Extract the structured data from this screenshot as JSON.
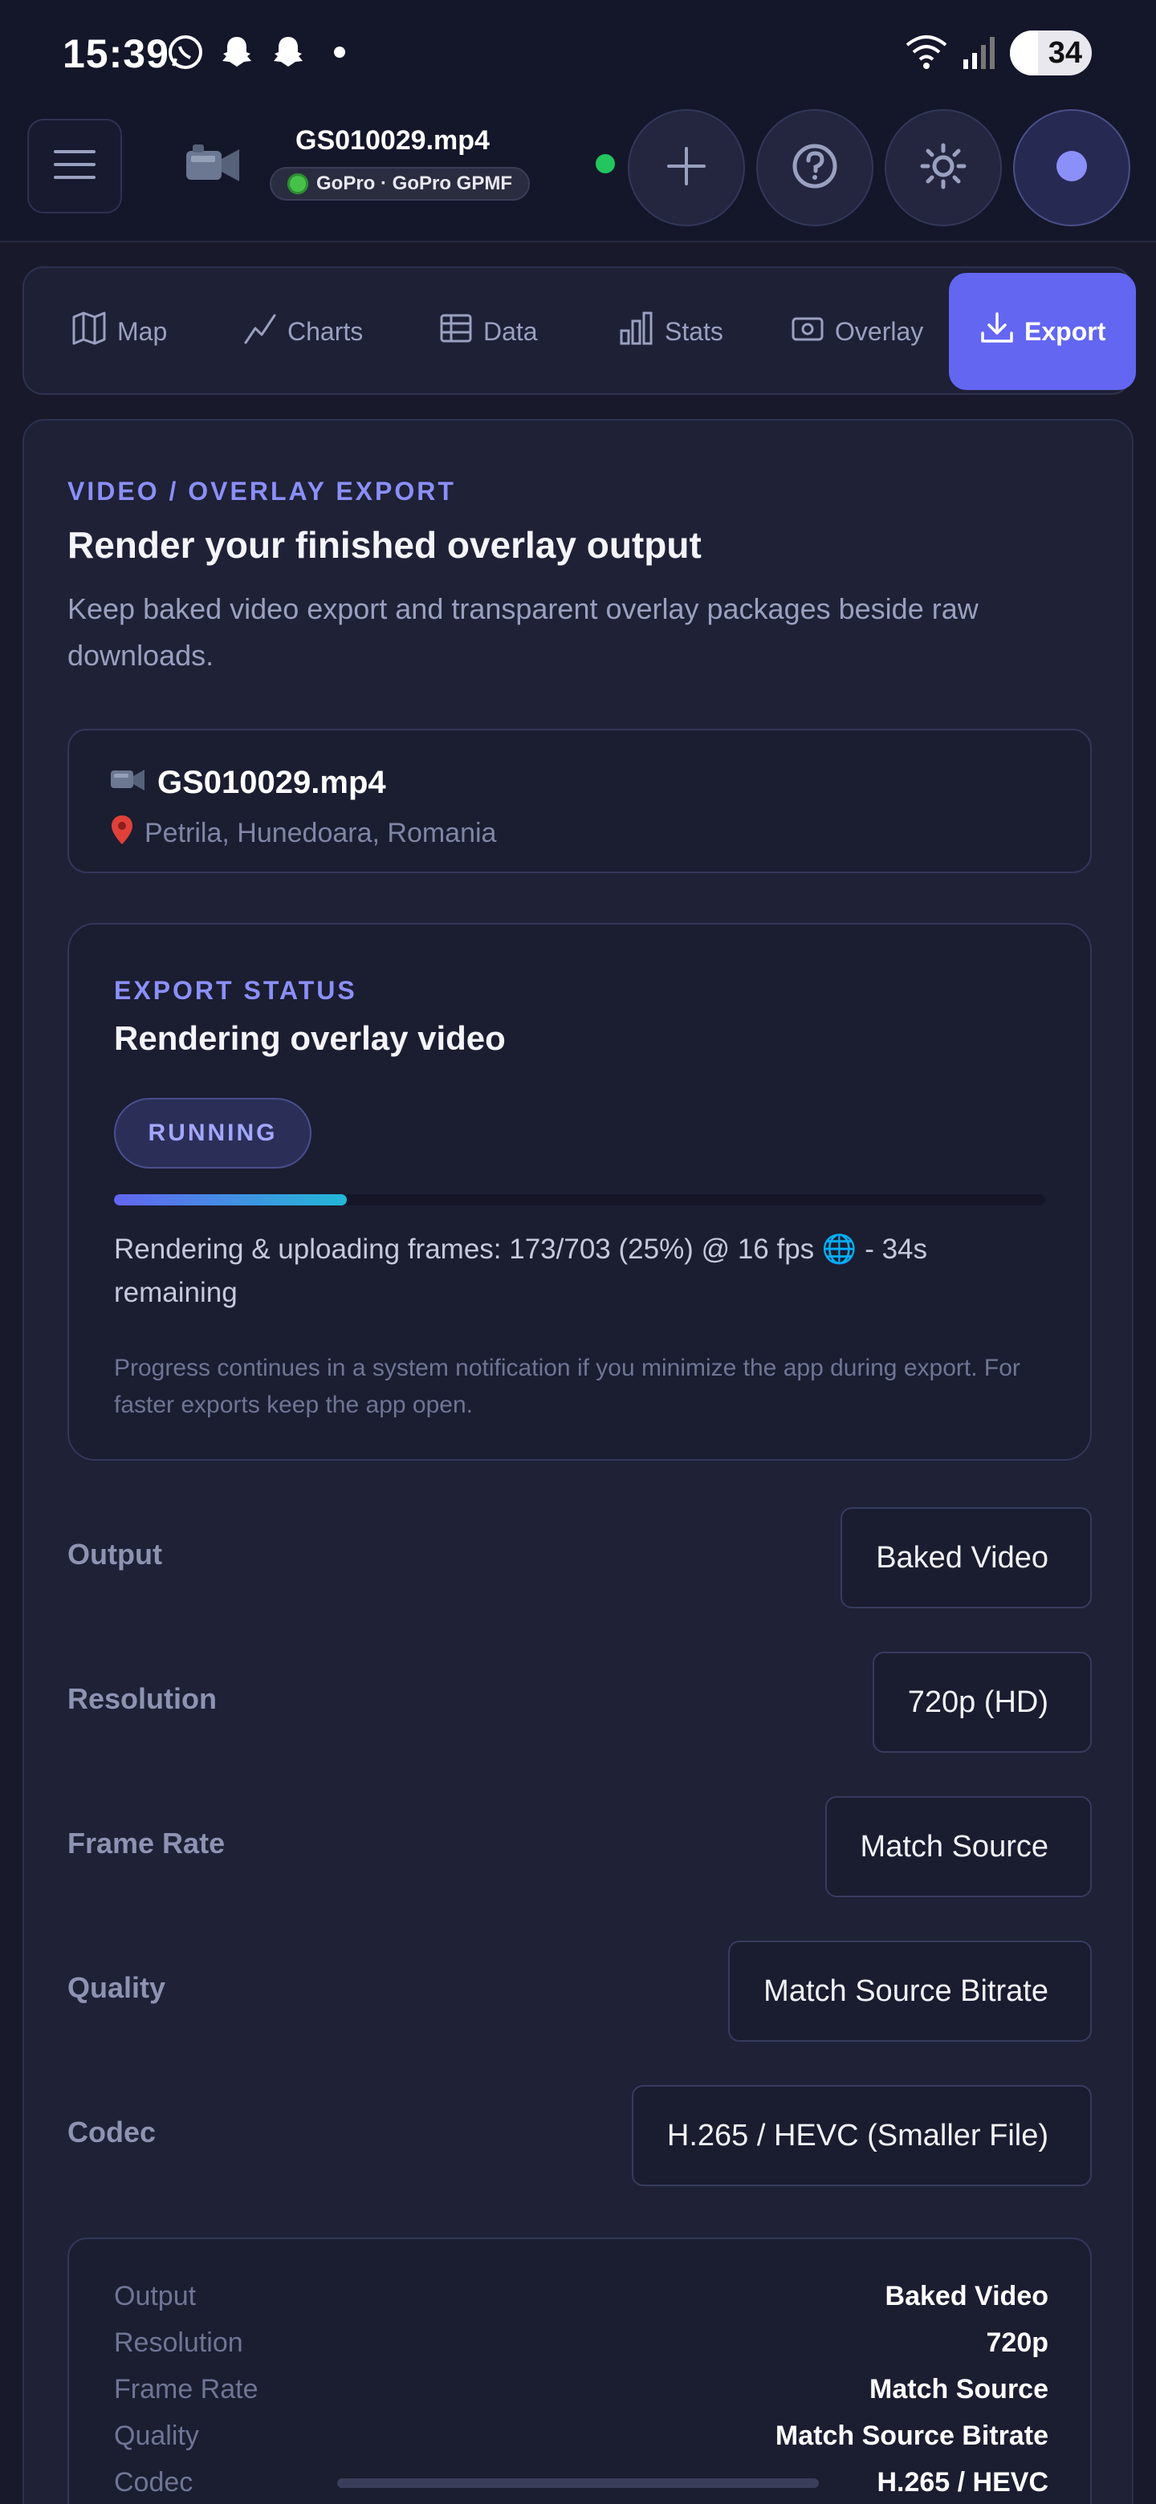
{
  "status_bar": {
    "time": "15:39",
    "notification_icons": [
      "whatsapp-icon",
      "snapchat-icon",
      "snapchat-icon",
      "more-dot-icon"
    ],
    "battery": "34"
  },
  "header": {
    "file_title": "GS010029.mp4",
    "device_badge": "GoPro · GoPro GPMF",
    "buttons": [
      "add-icon",
      "help-icon",
      "theme-icon",
      "profile-icon"
    ]
  },
  "tabs": [
    {
      "label": "Map",
      "icon": "map-icon"
    },
    {
      "label": "Charts",
      "icon": "chart-line-icon"
    },
    {
      "label": "Data",
      "icon": "table-icon"
    },
    {
      "label": "Stats",
      "icon": "bar-stats-icon"
    },
    {
      "label": "Overlay",
      "icon": "overlay-icon"
    },
    {
      "label": "Export",
      "icon": "download-icon",
      "active": true
    }
  ],
  "export": {
    "eyebrow": "VIDEO / OVERLAY EXPORT",
    "title": "Render your finished overlay output",
    "description": "Keep baked video export and transparent overlay packages beside raw downloads.",
    "file": {
      "name": "GS010029.mp4",
      "location": "Petrila, Hunedoara, Romania"
    },
    "status": {
      "eyebrow": "EXPORT STATUS",
      "title": "Rendering overlay video",
      "badge": "RUNNING",
      "progress_percent": 25,
      "progress_text": "Rendering & uploading frames: 173/703 (25%) @ 16 fps 🌐 - 34s remaining",
      "note": "Progress continues in a system notification if you minimize the app during export. For faster exports keep the app open."
    },
    "settings": [
      {
        "label": "Output",
        "value": "Baked Video"
      },
      {
        "label": "Resolution",
        "value": "720p (HD)"
      },
      {
        "label": "Frame Rate",
        "value": "Match Source"
      },
      {
        "label": "Quality",
        "value": "Match Source Bitrate"
      },
      {
        "label": "Codec",
        "value": "H.265 / HEVC (Smaller File)"
      }
    ],
    "summary": [
      {
        "key": "Output",
        "value": "Baked Video"
      },
      {
        "key": "Resolution",
        "value": "720p"
      },
      {
        "key": "Frame Rate",
        "value": "Match Source"
      },
      {
        "key": "Quality",
        "value": "Match Source Bitrate"
      },
      {
        "key": "Codec",
        "value": "H.265 / HEVC"
      }
    ]
  },
  "colors": {
    "accent": "#6366f1",
    "eyebrow": "#8b8ff8",
    "background": "#181a2b",
    "card": "#1f2136",
    "live": "#22c55e",
    "progress_end": "#22b8d6"
  }
}
